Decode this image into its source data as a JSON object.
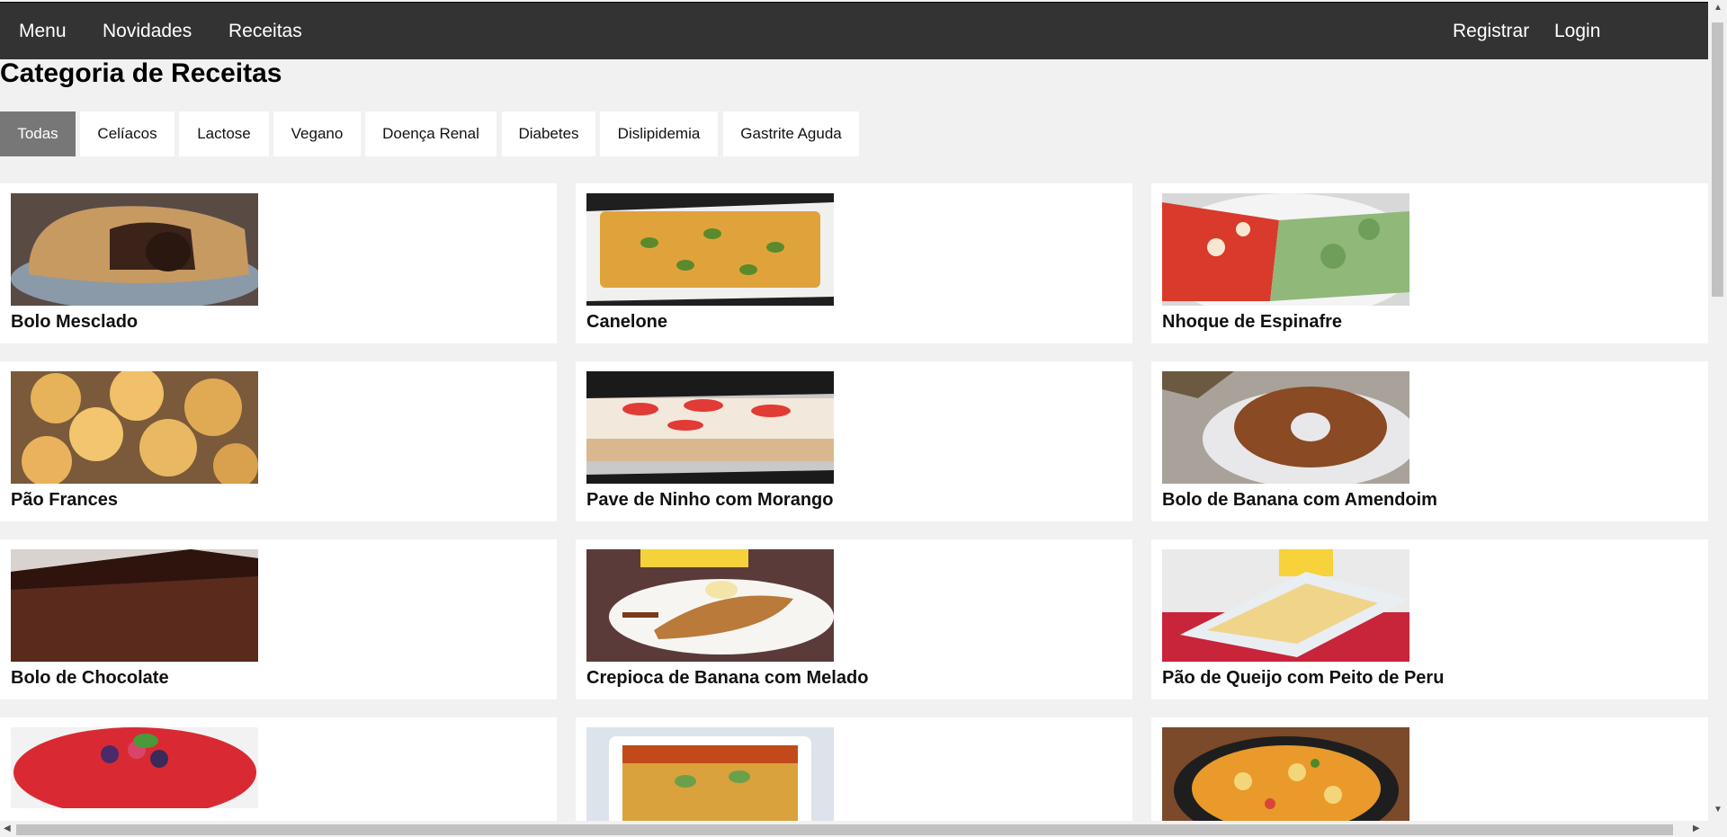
{
  "nav": {
    "left": [
      "Menu",
      "Novidades",
      "Receitas"
    ],
    "right": [
      "Registrar",
      "Login"
    ]
  },
  "page_title": "Categoria de Receitas",
  "categories": [
    "Todas",
    "Celíacos",
    "Lactose",
    "Vegano",
    "Doença Renal",
    "Diabetes",
    "Dislipidemia",
    "Gastrite Aguda"
  ],
  "active_category": "Todas",
  "recipes": [
    {
      "name": "Bolo Mesclado",
      "image": "marble-cake-photo"
    },
    {
      "name": "Canelone",
      "image": "cannelloni-photo"
    },
    {
      "name": "Nhoque de Espinafre",
      "image": "spinach-gnocchi-photo"
    },
    {
      "name": "Pão Frances",
      "image": "french-bread-photo"
    },
    {
      "name": "Pave de Ninho com Morango",
      "image": "strawberry-pave-photo"
    },
    {
      "name": "Bolo de Banana com Amendoim",
      "image": "banana-peanut-cake-photo"
    },
    {
      "name": "Bolo de Chocolate",
      "image": "chocolate-cake-photo"
    },
    {
      "name": "Crepioca de Banana com Melado",
      "image": "banana-crepioca-photo"
    },
    {
      "name": "Pão de Queijo com Peito de Peru",
      "image": "cheese-bread-turkey-photo"
    },
    {
      "name": "",
      "image": "berry-dessert-photo"
    },
    {
      "name": "",
      "image": "lasagna-photo"
    },
    {
      "name": "",
      "image": "moqueca-photo"
    }
  ],
  "colors": {
    "nav_bg": "#333333",
    "page_bg": "#f1f1f1",
    "active_tab": "#777777"
  }
}
